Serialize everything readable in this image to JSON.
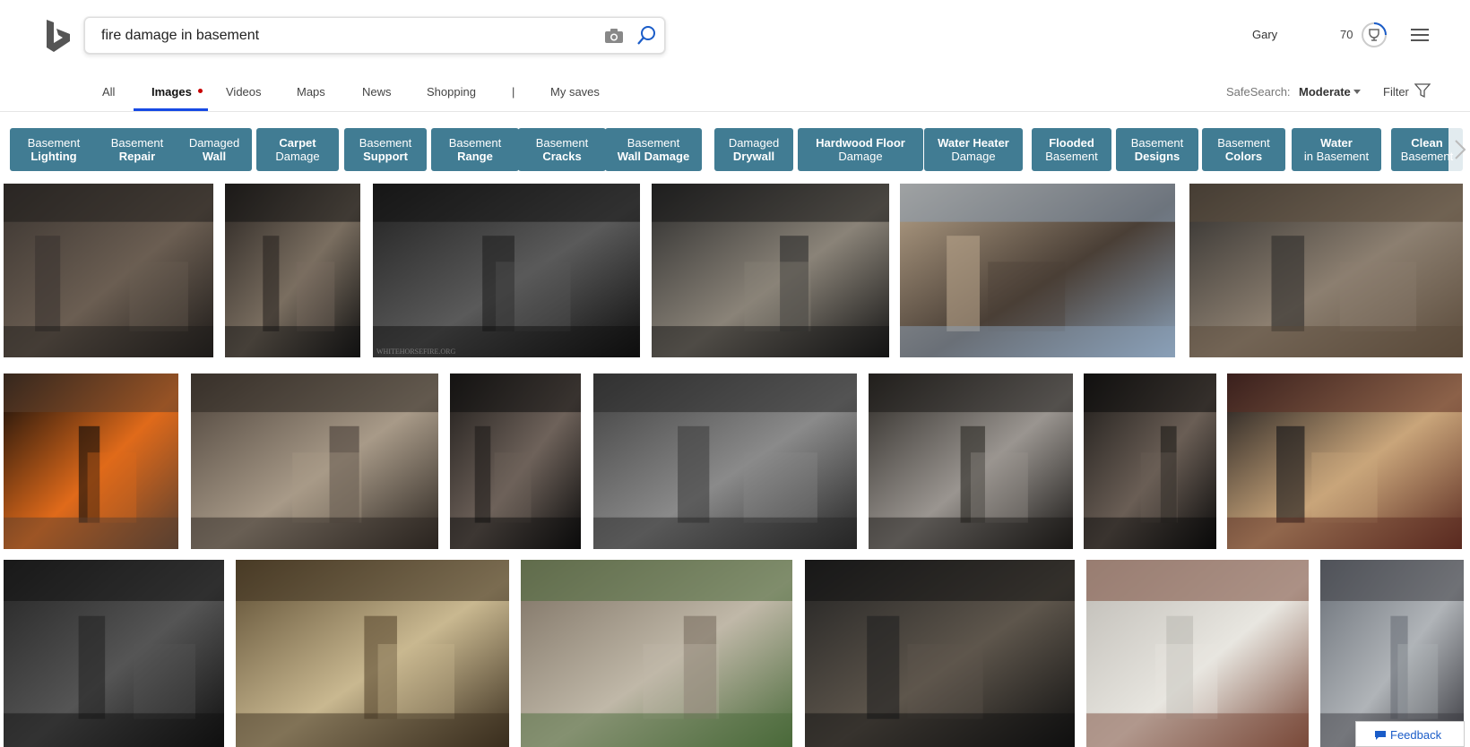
{
  "search": {
    "query": "fire damage in basement"
  },
  "user": {
    "name": "Gary",
    "rewards": "70"
  },
  "nav": {
    "items": [
      "All",
      "Images",
      "Videos",
      "Maps",
      "News",
      "Shopping",
      "|",
      "My saves"
    ],
    "safesearch_label": "SafeSearch:",
    "safesearch_value": "Moderate",
    "filter_label": "Filter"
  },
  "chips": [
    {
      "line1": "Basement",
      "line2": "Lighting",
      "bold": 2
    },
    {
      "line1": "Basement",
      "line2": "Repair",
      "bold": 2
    },
    {
      "line1": "Damaged",
      "line2": "Wall",
      "bold": 2
    },
    {
      "line1": "Carpet",
      "line2": "Damage",
      "bold": 1
    },
    {
      "line1": "Basement",
      "line2": "Support",
      "bold": 2
    },
    {
      "line1": "Basement",
      "line2": "Range",
      "bold": 2
    },
    {
      "line1": "Basement",
      "line2": "Cracks",
      "bold": 2
    },
    {
      "line1": "Basement",
      "line2": "Wall Damage",
      "bold": 2
    },
    {
      "line1": "Damaged",
      "line2": "Drywall",
      "bold": 2
    },
    {
      "line1": "Hardwood Floor",
      "line2": "Damage",
      "bold": 1
    },
    {
      "line1": "Water Heater",
      "line2": "Damage",
      "bold": 1
    },
    {
      "line1": "Flooded",
      "line2": "Basement",
      "bold": 1
    },
    {
      "line1": "Basement",
      "line2": "Designs",
      "bold": 2
    },
    {
      "line1": "Basement",
      "line2": "Colors",
      "bold": 2
    },
    {
      "line1": "Water",
      "line2": "in Basement",
      "bold": 1
    },
    {
      "line1": "Clean",
      "line2": "Basement",
      "bold": 1
    }
  ],
  "images": [
    {
      "name": "charred-basement-room",
      "palette": [
        "#3a3430",
        "#6b5e52",
        "#1e1b19"
      ]
    },
    {
      "name": "burnt-wood-stud-wall",
      "palette": [
        "#2a2522",
        "#7a6e60",
        "#111"
      ]
    },
    {
      "name": "burned-basement-ceiling",
      "palette": [
        "#202020",
        "#5a5a5a",
        "#0e0e0e"
      ],
      "watermark": "WHITEHORSEFIRE.ORG"
    },
    {
      "name": "burnt-basement-stairs",
      "palette": [
        "#2b2b2b",
        "#8a8378",
        "#141414"
      ]
    },
    {
      "name": "house-fire-firefighters",
      "palette": [
        "#b8a48a",
        "#4a3f36",
        "#8aa0b8"
      ]
    },
    {
      "name": "fire-debris-pile",
      "palette": [
        "#2e2d2c",
        "#8c7f70",
        "#5a4a3a"
      ]
    },
    {
      "name": "burning-staircase",
      "palette": [
        "#0a0a0a",
        "#e06a1a",
        "#5a4030"
      ]
    },
    {
      "name": "smoke-damaged-basement",
      "palette": [
        "#4a4038",
        "#a89a88",
        "#2a241f"
      ]
    },
    {
      "name": "dark-burnt-room",
      "palette": [
        "#1f1c1a",
        "#6e625a",
        "#0c0c0c"
      ]
    },
    {
      "name": "soot-covered-wall",
      "palette": [
        "#3f3f3f",
        "#8a8a8a",
        "#262626"
      ]
    },
    {
      "name": "burnt-basement-shelves",
      "palette": [
        "#2c2925",
        "#9a9590",
        "#191715"
      ]
    },
    {
      "name": "charred-framing",
      "palette": [
        "#1c1a18",
        "#6a5e55",
        "#0a0a0a"
      ]
    },
    {
      "name": "fire-truck-night",
      "palette": [
        "#141418",
        "#c9a57a",
        "#5a2a20"
      ]
    },
    {
      "name": "charred-ceiling-window",
      "palette": [
        "#242424",
        "#555",
        "#101010"
      ]
    },
    {
      "name": "damaged-basement-lit",
      "palette": [
        "#5a4a30",
        "#c9b890",
        "#3a2e1e"
      ]
    },
    {
      "name": "exterior-debris-cleanup",
      "palette": [
        "#7a6e60",
        "#c0b8a8",
        "#4a6a3a"
      ]
    },
    {
      "name": "burnt-stairs-basement",
      "palette": [
        "#222",
        "#5e564c",
        "#101010"
      ]
    },
    {
      "name": "restored-basement-water-heater",
      "palette": [
        "#bdbab4",
        "#e8e6e0",
        "#7a4a3a"
      ]
    },
    {
      "name": "collapsed-ceiling",
      "palette": [
        "#6a7078",
        "#b0b4b8",
        "#3a3a40"
      ]
    }
  ],
  "feedback_label": "Feedback"
}
